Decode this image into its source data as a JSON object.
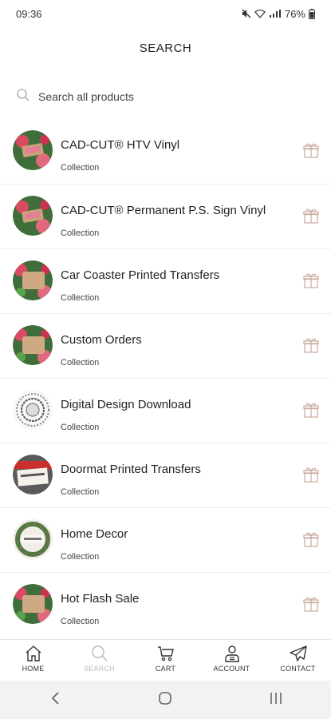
{
  "status_bar": {
    "time": "09:36",
    "battery": "76%",
    "icons": [
      "mute-icon",
      "wifi-icon",
      "signal-icon",
      "battery-icon"
    ]
  },
  "header": {
    "title": "SEARCH"
  },
  "search": {
    "placeholder": "Search all products",
    "value": ""
  },
  "results": [
    {
      "title": "CAD-CUT® HTV Vinyl",
      "subtitle": "Collection",
      "thumb": "floral-sign"
    },
    {
      "title": "CAD-CUT® Permanent P.S. Sign Vinyl",
      "subtitle": "Collection",
      "thumb": "floral-sign"
    },
    {
      "title": "Car Coaster Printed Transfers",
      "subtitle": "Collection",
      "thumb": "floral-board"
    },
    {
      "title": "Custom Orders",
      "subtitle": "Collection",
      "thumb": "floral-board"
    },
    {
      "title": "Digital Design Download",
      "subtitle": "Collection",
      "thumb": "mandala"
    },
    {
      "title": "Doormat Printed Transfers",
      "subtitle": "Collection",
      "thumb": "doormat"
    },
    {
      "title": "Home Decor",
      "subtitle": "Collection",
      "thumb": "wreath"
    },
    {
      "title": "Hot Flash Sale",
      "subtitle": "Collection",
      "thumb": "floral-board"
    }
  ],
  "bottom_nav": [
    {
      "label": "HOME",
      "icon": "home-icon",
      "active": false
    },
    {
      "label": "SEARCH",
      "icon": "search-icon",
      "active": true
    },
    {
      "label": "CART",
      "icon": "cart-icon",
      "active": false
    },
    {
      "label": "ACCOUNT",
      "icon": "account-icon",
      "active": false
    },
    {
      "label": "CONTACT",
      "icon": "send-icon",
      "active": false
    }
  ],
  "colors": {
    "accent_gift": "#c9a99e",
    "active_nav": "#b8b8b8",
    "divider": "#eeeeee",
    "system_bar": "#f2f2f2"
  }
}
